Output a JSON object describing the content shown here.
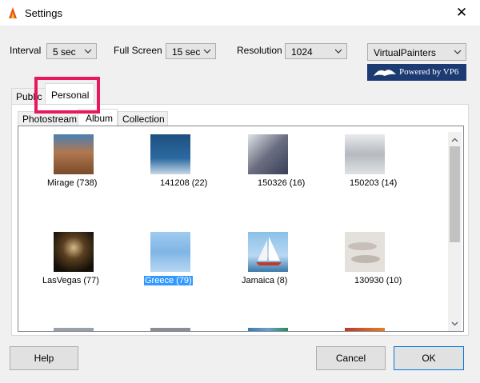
{
  "window": {
    "title": "Settings",
    "close_glyph": "✕"
  },
  "controls": {
    "interval": {
      "label": "Interval",
      "value": "5 sec"
    },
    "fullscreen": {
      "label": "Full Screen",
      "value": "15 sec"
    },
    "resolution": {
      "label": "Resolution",
      "value": "1024"
    },
    "brand": {
      "value": "VirtualPainters"
    },
    "banner_text": "Powered by VP6"
  },
  "tabs": {
    "top": [
      {
        "label": "Public"
      },
      {
        "label": "Personal"
      }
    ],
    "sub": [
      {
        "label": "Photostream"
      },
      {
        "label": "Album"
      },
      {
        "label": "Collection"
      }
    ],
    "active_top": "Personal",
    "active_sub": "Album"
  },
  "albums": [
    {
      "caption": "Mirage (738)",
      "thumb_color": "#8a5a3a"
    },
    {
      "caption": "141208 (22)",
      "thumb_color": "#2a5a8a"
    },
    {
      "caption": "150326 (16)",
      "thumb_color": "#6a6e80"
    },
    {
      "caption": "150203 (14)",
      "thumb_color": "#c9cdd2"
    },
    {
      "caption": "LasVegas (77)",
      "thumb_color": "#2a2218"
    },
    {
      "caption": "Greece (79)",
      "thumb_color": "#7fb3e0",
      "selected": true
    },
    {
      "caption": "Jamaica (8)",
      "thumb_color": "#7ab0d8"
    },
    {
      "caption": "130930 (10)",
      "thumb_color": "#d8d2cc"
    }
  ],
  "buttons": {
    "help": "Help",
    "cancel": "Cancel",
    "ok": "OK"
  },
  "colors": {
    "selection": "#3399ff",
    "highlight_box": "#e8185c",
    "banner_bg": "#1c3b73"
  }
}
